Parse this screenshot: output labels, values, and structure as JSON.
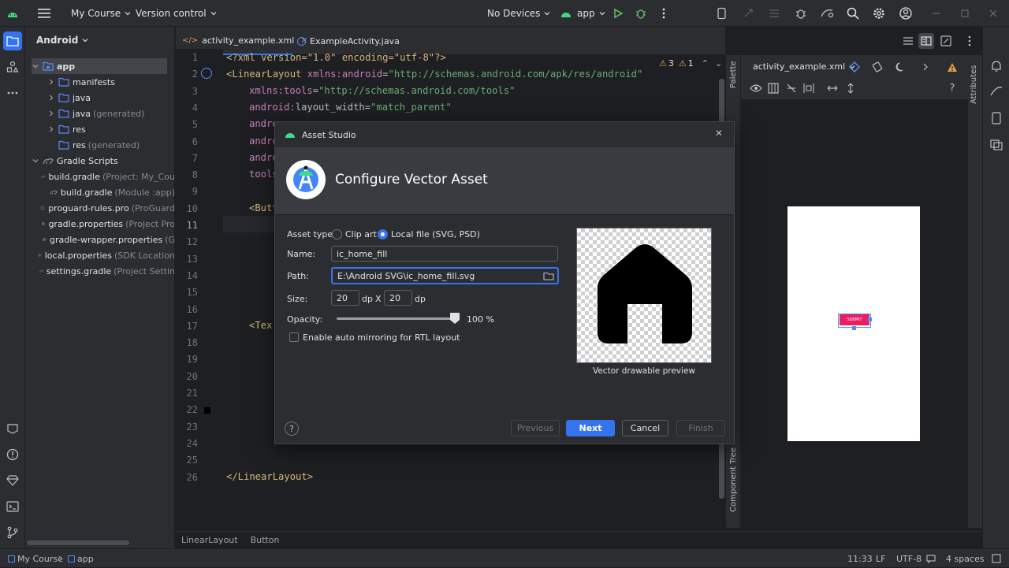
{
  "titlebar": {
    "project": "My Course",
    "vcs": "Version control",
    "devices": "No Devices",
    "run_config": "app"
  },
  "project_panel": {
    "view": "Android",
    "items": [
      {
        "label": "app",
        "sub": "",
        "level": 0,
        "type": "module",
        "expanded": true,
        "selected": true
      },
      {
        "label": "manifests",
        "sub": "",
        "level": 1,
        "type": "folder",
        "expanded": false
      },
      {
        "label": "java",
        "sub": "",
        "level": 1,
        "type": "folder",
        "expanded": false
      },
      {
        "label": "java",
        "sub": "(generated)",
        "level": 1,
        "type": "folder",
        "expanded": false
      },
      {
        "label": "res",
        "sub": "",
        "level": 1,
        "type": "folder",
        "expanded": false
      },
      {
        "label": "res",
        "sub": "(generated)",
        "level": 1,
        "type": "folder-leaf"
      },
      {
        "label": "Gradle Scripts",
        "sub": "",
        "level": 0,
        "type": "gradle",
        "expanded": true
      },
      {
        "label": "build.gradle",
        "sub": "(Project: My_Cou",
        "level": 1,
        "type": "gradle-file"
      },
      {
        "label": "build.gradle",
        "sub": "(Module :app)",
        "level": 1,
        "type": "gradle-file"
      },
      {
        "label": "proguard-rules.pro",
        "sub": "(ProGuard",
        "level": 1,
        "type": "file"
      },
      {
        "label": "gradle.properties",
        "sub": "(Project Pro",
        "level": 1,
        "type": "settings-file"
      },
      {
        "label": "gradle-wrapper.properties",
        "sub": "(G",
        "level": 1,
        "type": "settings-file"
      },
      {
        "label": "local.properties",
        "sub": "(SDK Location",
        "level": 1,
        "type": "settings-file"
      },
      {
        "label": "settings.gradle",
        "sub": "(Project Settin",
        "level": 1,
        "type": "gradle-file"
      }
    ]
  },
  "tabs": [
    {
      "label": "activity_example.xml",
      "active": true
    },
    {
      "label": "ExampleActivity.java",
      "active": false
    }
  ],
  "editor": {
    "line_numbers": [
      "1",
      "2",
      "3",
      "4",
      "5",
      "6",
      "7",
      "8",
      "9",
      "10",
      "11",
      "12",
      "13",
      "14",
      "15",
      "16",
      "17",
      "18",
      "19",
      "20",
      "21",
      "22",
      "23",
      "24",
      "25",
      "26"
    ],
    "current_line": "11",
    "warnings": "3",
    "weak_warnings": "1",
    "code": {
      "l1": "<?xml version=\"1.0\" encoding=\"utf-8\"?>",
      "l2_tag": "<LinearLayout ",
      "l2_ns": "xmlns:",
      "l2_attr": "android",
      "l2_eq": "=",
      "l2_val": "\"http://schemas.android.com/apk/res/android\"",
      "l3_ns": "xmlns:",
      "l3_attr": "tools",
      "l3_eq": "=",
      "l3_val": "\"http://schemas.android.com/tools\"",
      "l4_ns": "android:",
      "l4_attr": "layout_width",
      "l4_eq": "=",
      "l4_val": "\"match_parent\"",
      "l5": "andro",
      "l6": "andro",
      "l7": "andro",
      "l8": "tools",
      "l10": "<Butt",
      "l17": "<Tex",
      "l26": "</LinearLayout>"
    }
  },
  "design": {
    "file": "activity_example.xml",
    "palette_label": "Palette",
    "component_tree_label": "Component Tree",
    "attributes_label": "Attributes",
    "button_text": "SUBMIT"
  },
  "breadcrumb": [
    "LinearLayout",
    "Button"
  ],
  "statusbar": {
    "project": "My Course",
    "module": "app",
    "position": "11:33",
    "line_sep": "LF",
    "encoding": "UTF-8",
    "indent": "4 spaces"
  },
  "dialog": {
    "title": "Asset Studio",
    "heading": "Configure Vector Asset",
    "asset_type_label": "Asset type:",
    "asset_type_options": [
      "Clip art",
      "Local file (SVG, PSD)"
    ],
    "asset_type_selected": "Local file (SVG, PSD)",
    "name_label": "Name:",
    "name_value": "ic_home_fill",
    "path_label": "Path:",
    "path_value": "E:\\Android SVG\\ic_home_fill.svg",
    "size_label": "Size:",
    "width": "20",
    "height": "20",
    "unit": "dp",
    "times": "X",
    "opacity_label": "Opacity:",
    "opacity_value": "100 %",
    "opacity": 1.0,
    "rtl_label": "Enable auto mirroring for RTL layout",
    "rtl_checked": false,
    "preview_caption": "Vector drawable preview",
    "help": "?",
    "buttons": {
      "previous": "Previous",
      "next": "Next",
      "cancel": "Cancel",
      "finish": "Finish"
    }
  }
}
